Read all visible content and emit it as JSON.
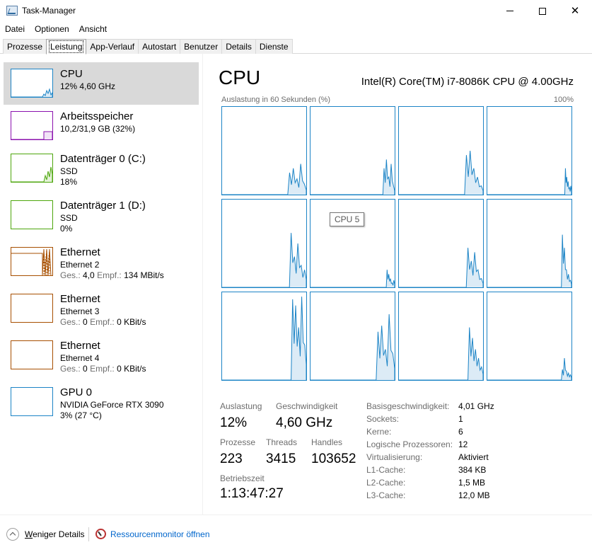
{
  "window": {
    "title": "Task-Manager"
  },
  "menu": [
    "Datei",
    "Optionen",
    "Ansicht"
  ],
  "tabs": [
    "Prozesse",
    "Leistung",
    "App-Verlauf",
    "Autostart",
    "Benutzer",
    "Details",
    "Dienste"
  ],
  "active_tab": "Leistung",
  "sidebar": {
    "items": [
      {
        "title": "CPU",
        "lines": [
          "12%  4,60 GHz"
        ],
        "color": "#1c84c6",
        "selected": true
      },
      {
        "title": "Arbeitsspeicher",
        "lines": [
          "10,2/31,9 GB (32%)"
        ],
        "color": "#8b12ae"
      },
      {
        "title": "Datenträger 0 (C:)",
        "lines": [
          "SSD",
          "18%"
        ],
        "color": "#4da60c"
      },
      {
        "title": "Datenträger 1 (D:)",
        "lines": [
          "SSD",
          "0%"
        ],
        "color": "#4da60c"
      },
      {
        "title": "Ethernet",
        "lines": [
          "Ethernet 2"
        ],
        "ges": "4,0",
        "empf": "134 MBit/s",
        "color": "#a74f01"
      },
      {
        "title": "Ethernet",
        "lines": [
          "Ethernet 3"
        ],
        "ges": "0",
        "empf": "0 KBit/s",
        "color": "#a74f01"
      },
      {
        "title": "Ethernet",
        "lines": [
          "Ethernet 4"
        ],
        "ges": "0",
        "empf": "0 KBit/s",
        "color": "#a74f01"
      },
      {
        "title": "GPU 0",
        "lines": [
          "NVIDIA GeForce RTX 3090",
          "3% (27 °C)"
        ],
        "color": "#1c84c6"
      }
    ],
    "ges_label": "Ges.:",
    "empf_label": "Empf.:"
  },
  "main": {
    "title": "CPU",
    "cpu_name": "Intel(R) Core(TM) i7-8086K CPU @ 4.00GHz",
    "graph_caption": "Auslastung in 60 Sekunden (%)",
    "graph_max": "100%",
    "tooltip": "CPU 5",
    "stats": {
      "utilization_label": "Auslastung",
      "utilization": "12%",
      "speed_label": "Geschwindigkeit",
      "speed": "4,60 GHz",
      "processes_label": "Prozesse",
      "processes": "223",
      "threads_label": "Threads",
      "threads": "3415",
      "handles_label": "Handles",
      "handles": "103652",
      "uptime_label": "Betriebszeit",
      "uptime": "1:13:47:27"
    },
    "specs": [
      {
        "label": "Basisgeschwindigkeit:",
        "value": "4,01 GHz"
      },
      {
        "label": "Sockets:",
        "value": "1"
      },
      {
        "label": "Kerne:",
        "value": "6"
      },
      {
        "label": "Logische Prozessoren:",
        "value": "12"
      },
      {
        "label": "Virtualisierung:",
        "value": "Aktiviert"
      },
      {
        "label": "L1-Cache:",
        "value": "384 KB"
      },
      {
        "label": "L2-Cache:",
        "value": "1,5 MB"
      },
      {
        "label": "L3-Cache:",
        "value": "12,0 MB"
      }
    ]
  },
  "footer": {
    "less_details": "Weniger Details",
    "less_details_hotkey": "W",
    "resource_monitor": "Ressourcenmonitor öffnen"
  },
  "colors": {
    "cpu": "#1c84c6",
    "memory": "#8b12ae",
    "disk": "#4da60c",
    "ethernet": "#a74f01",
    "selected": "#d9d9d9",
    "link": "#0066cc"
  }
}
